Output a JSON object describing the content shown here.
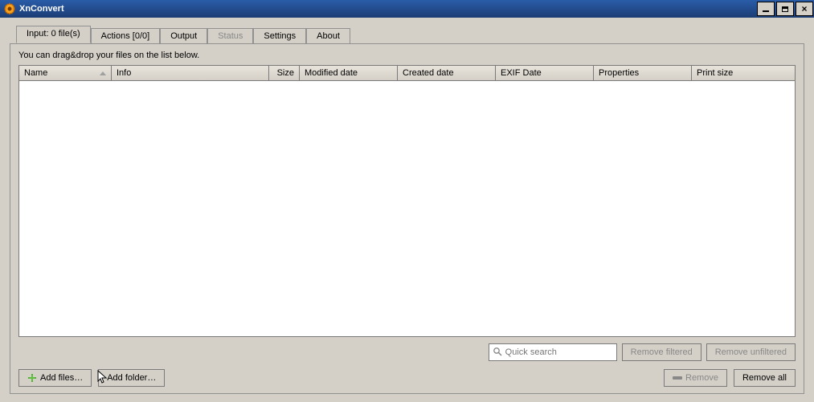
{
  "window": {
    "title": "XnConvert"
  },
  "tabs": {
    "input": "Input: 0 file(s)",
    "actions": "Actions [0/0]",
    "output": "Output",
    "status": "Status",
    "settings": "Settings",
    "about": "About"
  },
  "hint": "You can drag&drop your files on the list below.",
  "columns": {
    "name": "Name",
    "info": "Info",
    "size": "Size",
    "modified": "Modified date",
    "created": "Created date",
    "exif": "EXIF Date",
    "properties": "Properties",
    "print_size": "Print size"
  },
  "search": {
    "placeholder": "Quick search"
  },
  "buttons": {
    "remove_filtered": "Remove filtered",
    "remove_unfiltered": "Remove unfiltered",
    "add_files": "Add files…",
    "add_folder": "Add folder…",
    "remove": "Remove",
    "remove_all": "Remove all"
  }
}
